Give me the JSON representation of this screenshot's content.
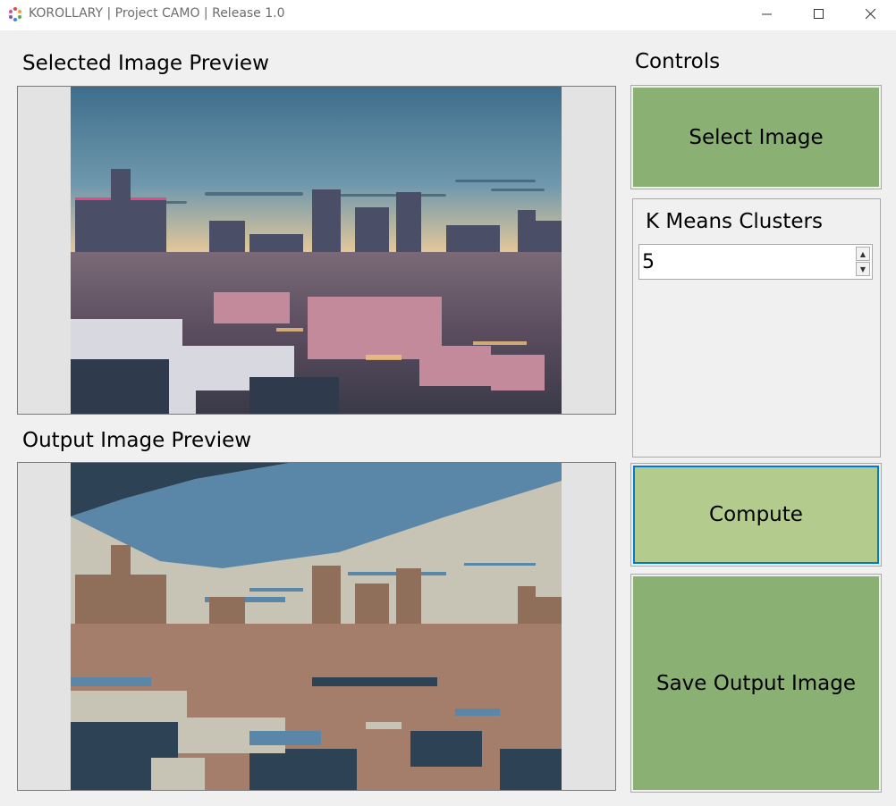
{
  "window": {
    "title": "KOROLLARY | Project CAMO | Release 1.0",
    "app_icon": "korollary-logo-icon",
    "minimize_icon": "minimize-icon",
    "maximize_icon": "maximize-icon",
    "close_icon": "close-icon"
  },
  "left_panel": {
    "selected_label": "Selected Image Preview",
    "output_label": "Output Image Preview"
  },
  "controls": {
    "heading": "Controls",
    "select_image_label": "Select Image",
    "kmeans": {
      "label": "K Means Clusters",
      "value": "5",
      "up_icon": "spin-up-icon",
      "down_icon": "spin-down-icon"
    },
    "compute_label": "Compute",
    "save_label": "Save Output Image"
  },
  "colors": {
    "button_green": "#8ab173",
    "compute_green": "#b3cb8d",
    "compute_focus_border": "#0078d7",
    "background": "#f0f0f0"
  }
}
